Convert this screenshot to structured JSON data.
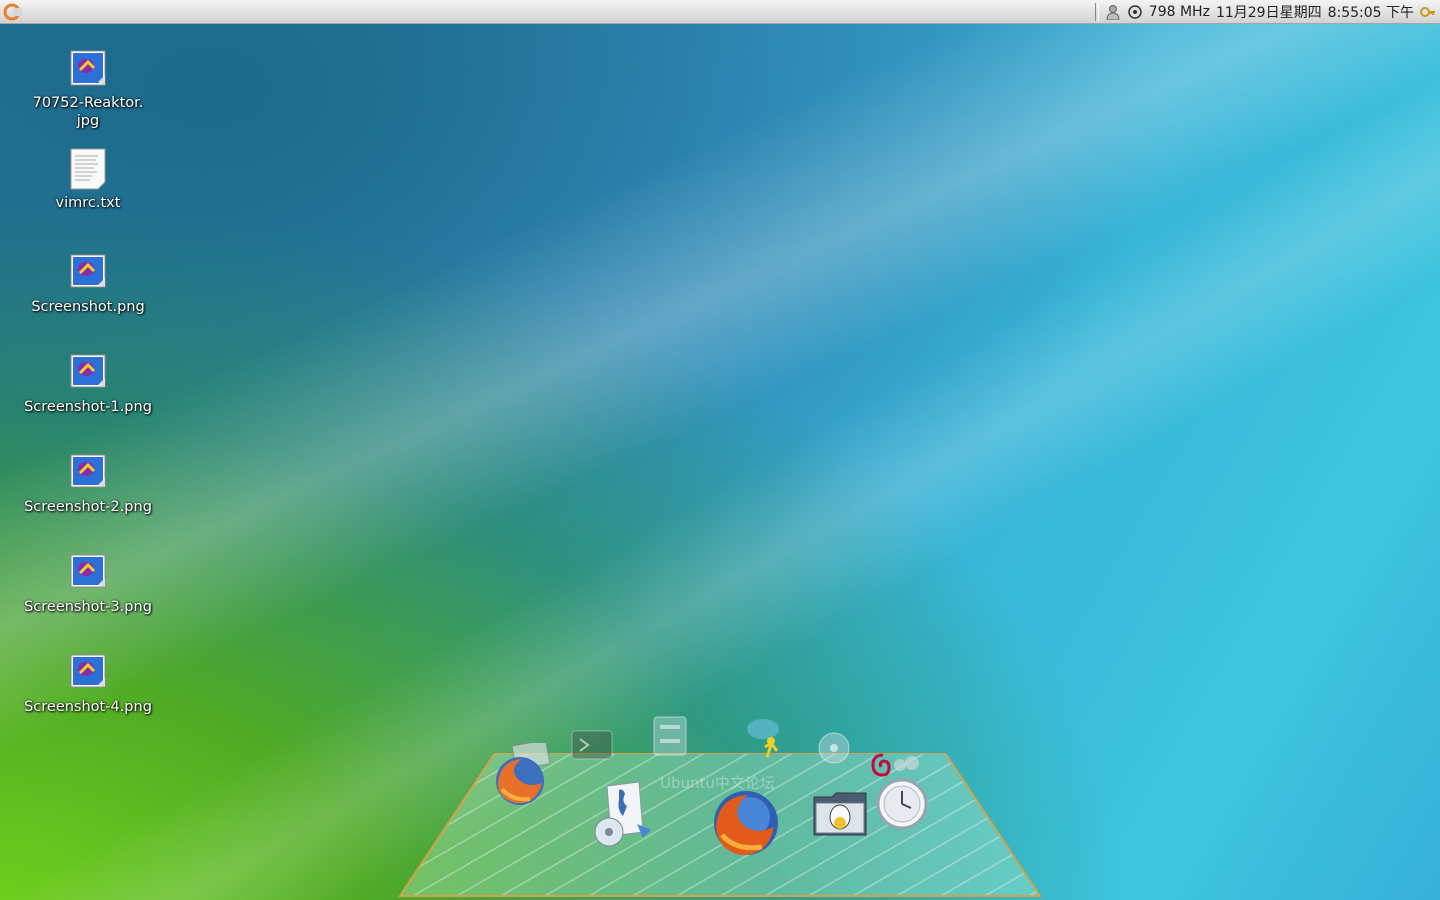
{
  "top_panel": {
    "cpu_freq": "798 MHz",
    "date": "11月29日星期四",
    "time": "8:55:05 下午"
  },
  "desktop_icons": [
    {
      "label": "70752-Reaktor.\njpg",
      "label_line1": "70752-Reaktor.",
      "label_line2": "jpg",
      "type": "image"
    },
    {
      "label": "vimrc.txt",
      "type": "text"
    },
    {
      "label": "Screenshot.png",
      "type": "image"
    },
    {
      "label": "Screenshot-1.png",
      "type": "image"
    },
    {
      "label": "Screenshot-2.png",
      "type": "image"
    },
    {
      "label": "Screenshot-3.png",
      "type": "image"
    },
    {
      "label": "Screenshot-4.png",
      "type": "image"
    }
  ],
  "dock": {
    "ghost_labels": [
      "Ubuntu中文论坛"
    ],
    "items": [
      "firefox-small-icon",
      "terminal-icon",
      "file-cabinet-icon",
      "aim-icon",
      "cd-icon",
      "debian-icon",
      "gimp-icon",
      "software-installer-icon",
      "firefox-icon",
      "home-folder-icon",
      "clock-icon"
    ]
  },
  "colors": {
    "panel_bg": "#dedede",
    "dock_border": "#d7a14a"
  }
}
